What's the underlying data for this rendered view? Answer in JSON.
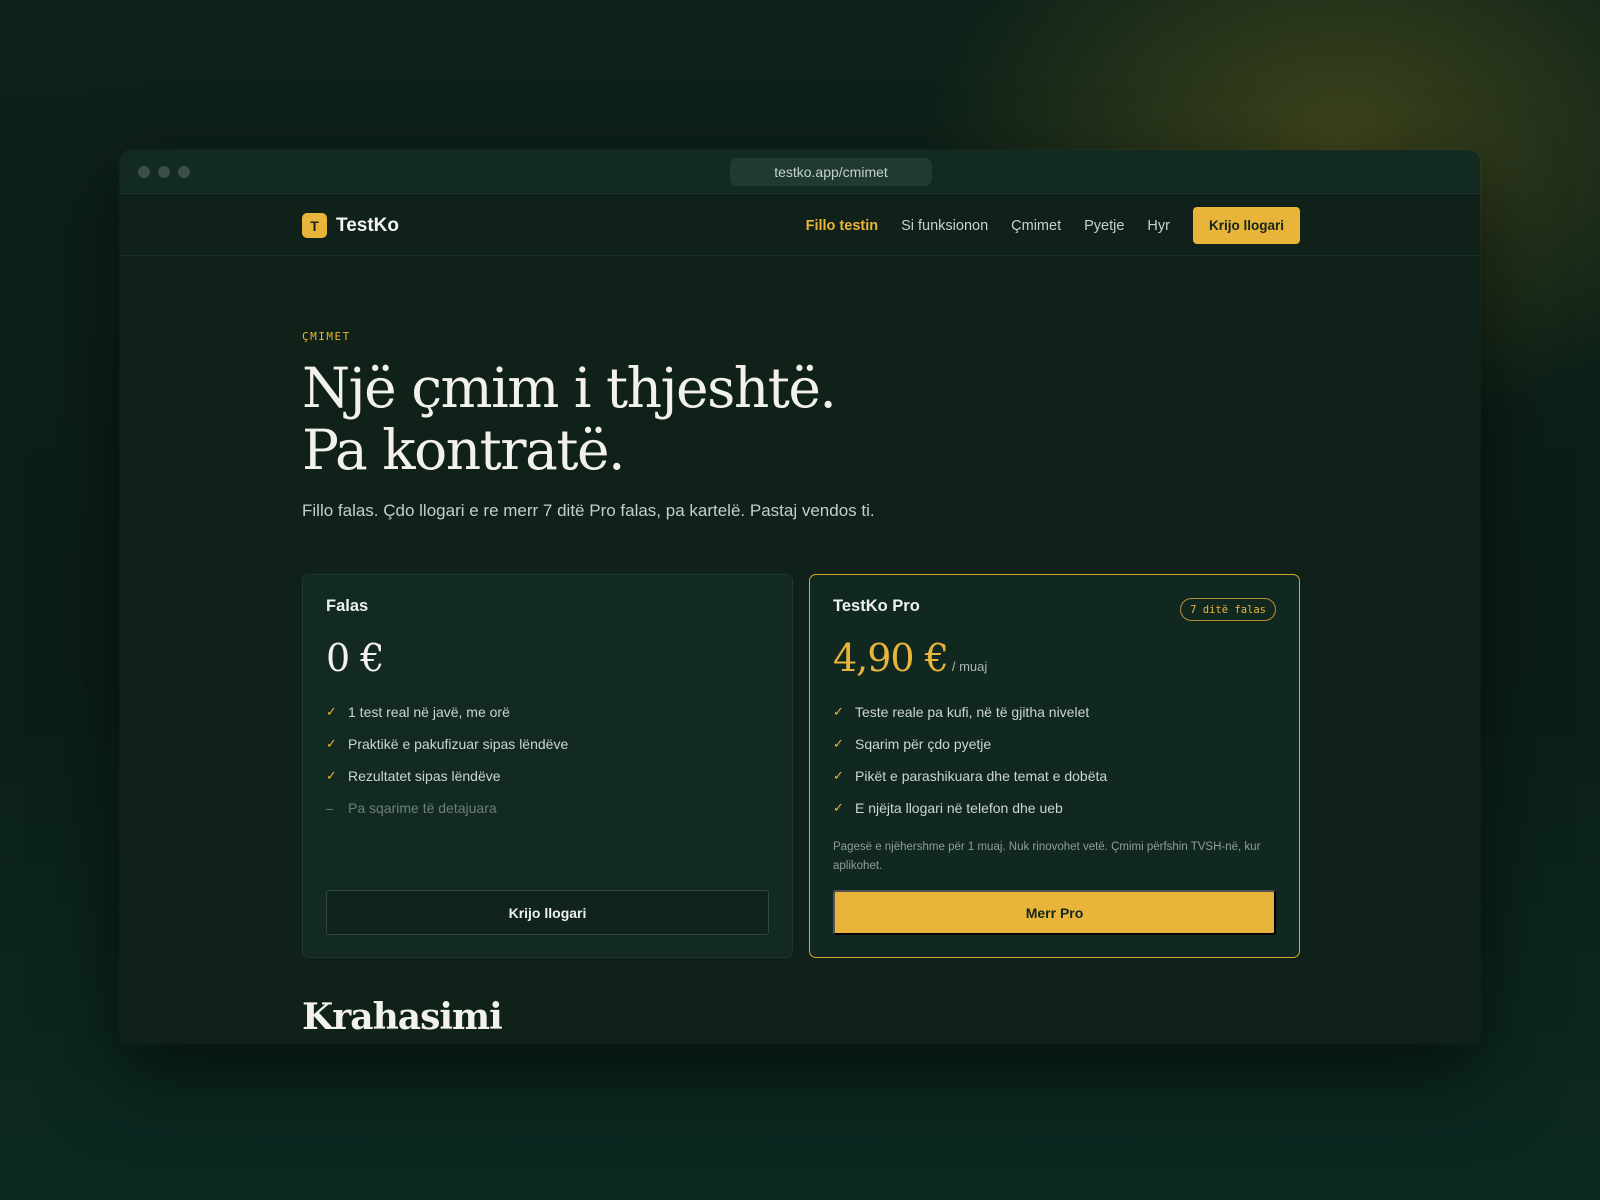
{
  "browser": {
    "url": "testko.app/cmimet"
  },
  "nav": {
    "brand_mark": "T",
    "brand_name": "TestKo",
    "links": [
      "Fillo testin",
      "Si funksionon",
      "Çmimet",
      "Pyetje",
      "Hyr"
    ],
    "cta": "Krijo llogari"
  },
  "hero": {
    "eyebrow": "ÇMIMET",
    "headline_line1": "Një çmim i thjeshtë.",
    "headline_line2": "Pa kontratë.",
    "subtitle": "Fillo falas. Çdo llogari e re merr 7 ditë Pro falas, pa kartelë. Pastaj vendos ti."
  },
  "plans": {
    "free": {
      "name": "Falas",
      "price": "0 €",
      "features": [
        "1 test real në javë, me orë",
        "Praktikë e pakufizuar sipas lëndëve",
        "Rezultatet sipas lëndëve"
      ],
      "excluded": "Pa sqarime të detajuara",
      "button": "Krijo llogari"
    },
    "pro": {
      "name": "TestKo Pro",
      "badge": "7 ditë falas",
      "price": "4,90 €",
      "period": "/ muaj",
      "features": [
        "Teste reale pa kufi, në të gjitha nivelet",
        "Sqarim për çdo pyetje",
        "Pikët e parashikuara dhe temat e dobëta",
        "E njëjta llogari në telefon dhe ueb"
      ],
      "note": "Pagesë e njëhershme për 1 muaj. Nuk rinovohet vetë. Çmimi përfshin TVSH-në, kur aplikohet.",
      "button": "Merr Pro"
    }
  },
  "comparison": {
    "title": "Krahasimi"
  },
  "icons": {
    "check": "check-icon",
    "dash": "dash-icon"
  },
  "colors": {
    "accent": "#e8b53a",
    "background": "#0f2119",
    "card": "#122a21"
  }
}
